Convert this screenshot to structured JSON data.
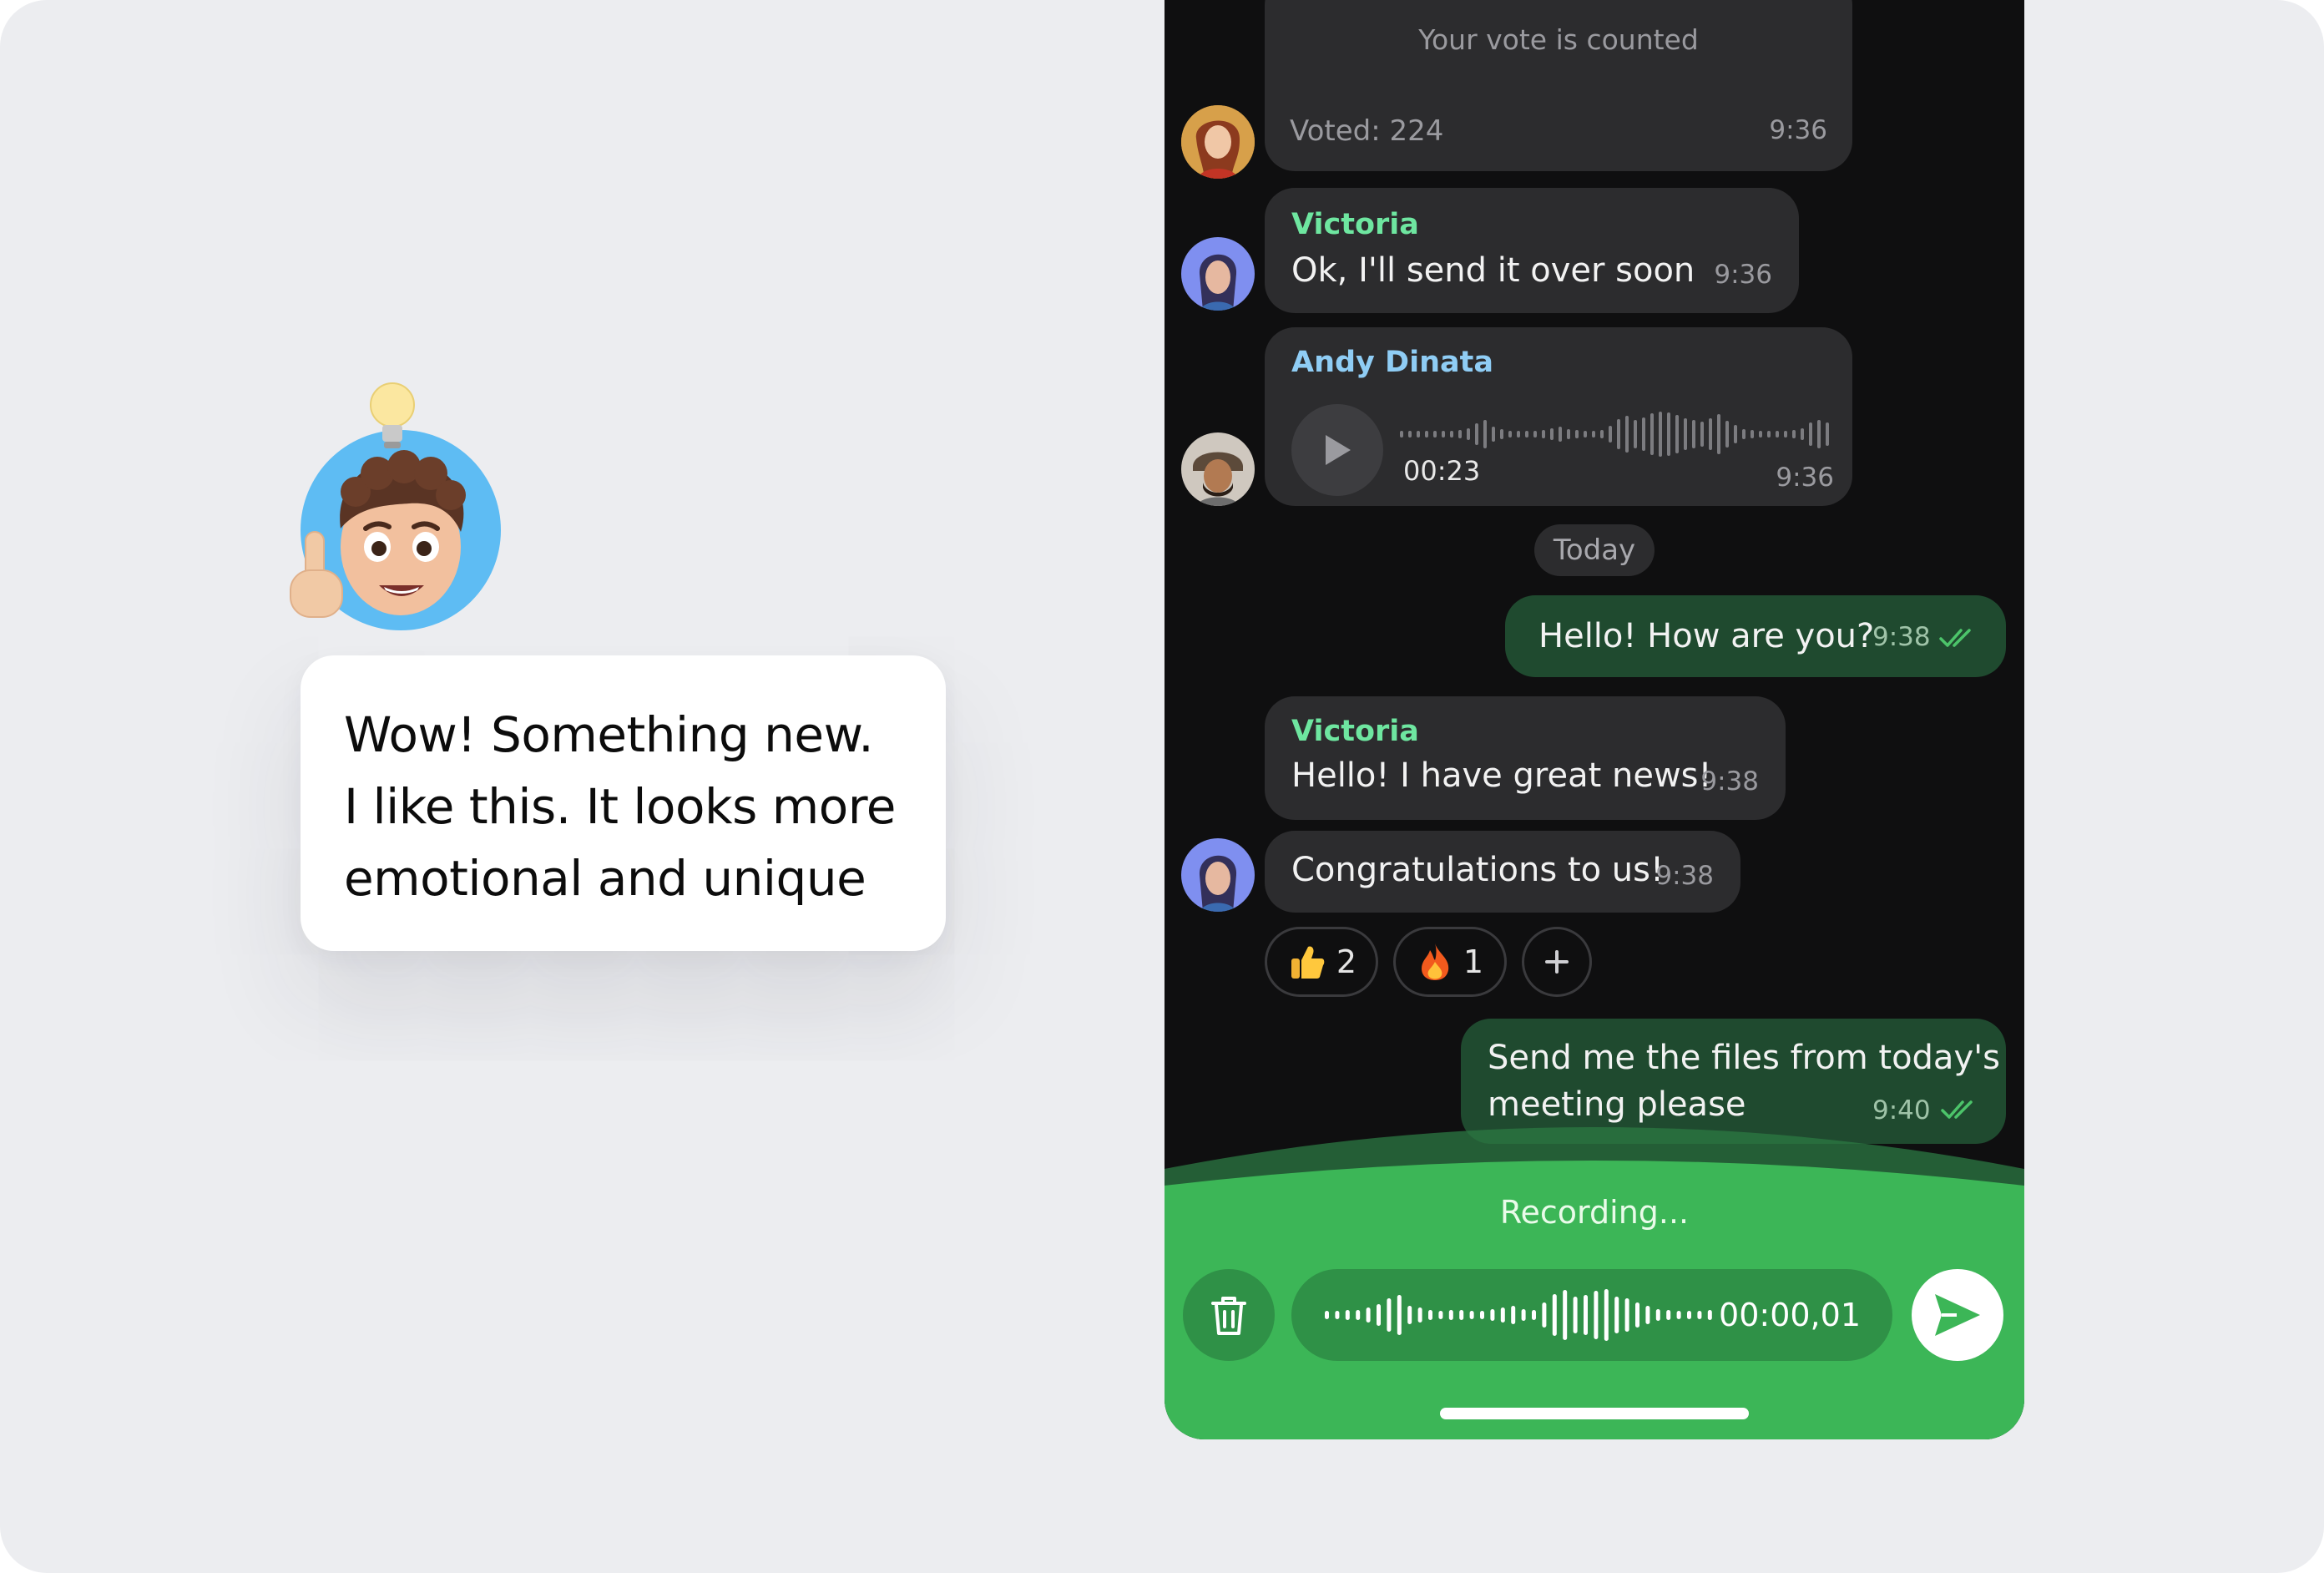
{
  "quote": {
    "line1": "Wow! Something new.",
    "line2": "I like this. It looks more",
    "line3": "emotional and unique"
  },
  "chat": {
    "poll": {
      "status": "Your vote is counted",
      "voted": "Voted: 224",
      "time": "9:36"
    },
    "msg1": {
      "sender": "Victoria",
      "text": "Ok, I'll send it over soon",
      "time": "9:36"
    },
    "voice": {
      "sender": "Andy Dinata",
      "duration": "00:23",
      "time": "9:36"
    },
    "date_separator": "Today",
    "out1": {
      "text": "Hello! How are you?",
      "time": "9:38"
    },
    "msg2": {
      "sender": "Victoria",
      "text": "Hello! I have great news!",
      "time": "9:38"
    },
    "msg3": {
      "text": "Congratulations to us!",
      "time": "9:38"
    },
    "reactions": [
      {
        "emoji": "thumbs-up",
        "count": "2"
      },
      {
        "emoji": "fire",
        "count": "1"
      }
    ],
    "out2": {
      "line1": "Send me the files from today's",
      "line2": "meeting please",
      "time": "9:40"
    }
  },
  "recording": {
    "title": "Recording...",
    "timer": "00:00,01"
  },
  "colors": {
    "victoria": "#6ee6a0",
    "andy": "#8fcdf5",
    "recording_green": "#3cb657",
    "outgoing_bubble": "#1f4a2f"
  }
}
